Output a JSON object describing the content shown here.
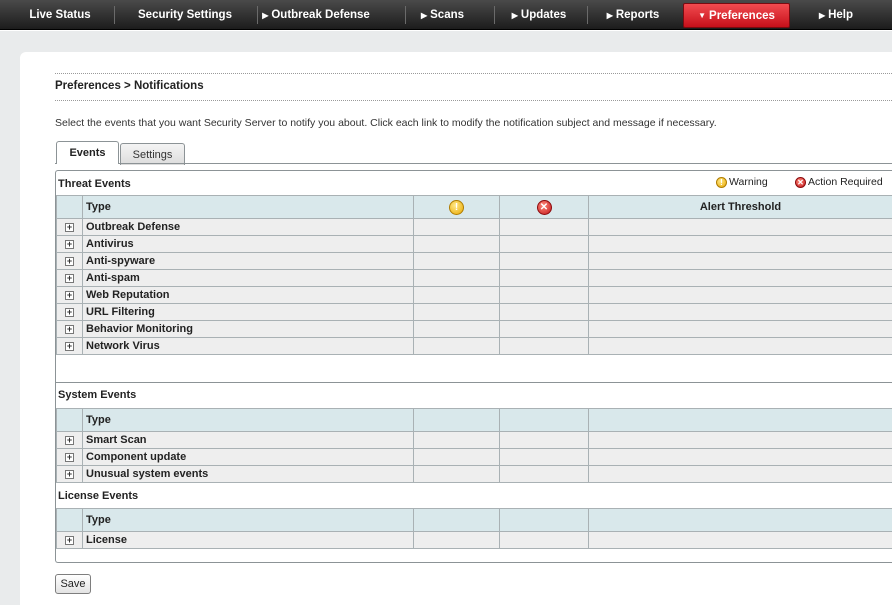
{
  "nav": {
    "items": [
      {
        "label": "Live Status",
        "arrow": ""
      },
      {
        "label": "Security Settings",
        "arrow": ""
      },
      {
        "label": "Outbreak Defense",
        "arrow": "▶"
      },
      {
        "label": "Scans",
        "arrow": "▶"
      },
      {
        "label": "Updates",
        "arrow": "▶"
      },
      {
        "label": "Reports",
        "arrow": "▶"
      },
      {
        "label": "Preferences",
        "arrow": "▼"
      },
      {
        "label": "Help",
        "arrow": "▶"
      }
    ],
    "active_index": 6,
    "active_color": "#d9212a"
  },
  "page": {
    "breadcrumb": "Preferences > Notifications",
    "description": "Select the events that you want Security Server to notify you about. Click each link to modify the notification subject and message if necessary."
  },
  "tabs": [
    {
      "label": "Events",
      "selected": true
    },
    {
      "label": "Settings",
      "selected": false
    }
  ],
  "legend": {
    "warning_label": "Warning",
    "warning_icon": "warning-icon",
    "warning_color": "#f2c200",
    "action_label": "Action Required",
    "action_icon": "action-required-icon",
    "action_color": "#d42020"
  },
  "threat_events": {
    "title": "Threat Events",
    "columns": {
      "type": "Type",
      "threshold": "Alert Threshold"
    },
    "rows": [
      "Outbreak Defense",
      "Antivirus",
      "Anti-spyware",
      "Anti-spam",
      "Web Reputation",
      "URL Filtering",
      "Behavior Monitoring",
      "Network Virus"
    ]
  },
  "system_events": {
    "title": "System Events",
    "columns": {
      "type": "Type"
    },
    "rows": [
      "Smart Scan",
      "Component update",
      "Unusual system events"
    ]
  },
  "license_events": {
    "title": "License Events",
    "columns": {
      "type": "Type"
    },
    "rows": [
      "License"
    ]
  },
  "save_label": "Save"
}
